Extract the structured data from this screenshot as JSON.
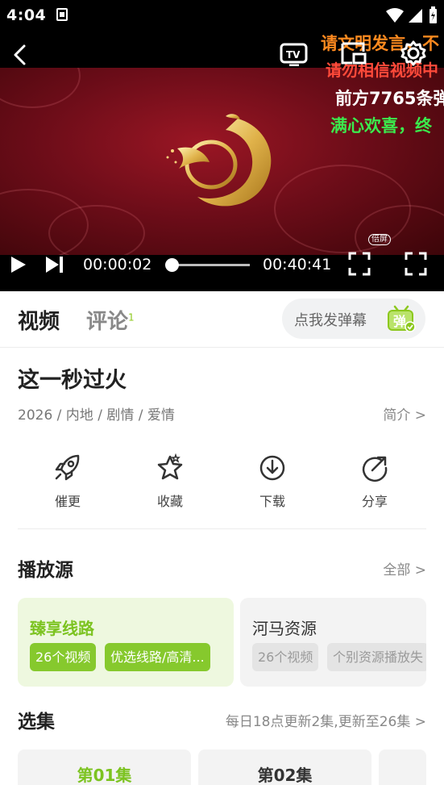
{
  "status_bar": {
    "time": "4:04"
  },
  "player": {
    "danmaku": [
      "请文明发言，不",
      "请勿相信视频中",
      "前方7765条弹",
      "满心欢喜，终"
    ],
    "current_time": "00:00:02",
    "total_time": "00:40:41",
    "speed_tag": "倍屏",
    "progress": 0.02
  },
  "tabs": [
    {
      "label": "视频",
      "active": true
    },
    {
      "label": "评论",
      "badge": "1",
      "active": false
    }
  ],
  "danmu_input": {
    "placeholder": "点我发弹幕",
    "icon_text": "弹"
  },
  "show": {
    "title": "这一秒过火",
    "meta": "2026 / 内地 / 剧情 / 爱情",
    "intro_link": "简介 >"
  },
  "actions": [
    {
      "icon": "rocket-icon",
      "label": "催更"
    },
    {
      "icon": "star-icon",
      "label": "收藏"
    },
    {
      "icon": "download-icon",
      "label": "下载"
    },
    {
      "icon": "share-icon",
      "label": "分享"
    }
  ],
  "sources": {
    "title": "播放源",
    "more": "全部 >",
    "items": [
      {
        "name": "臻享线路",
        "chips": [
          "26个视频",
          "优选线路/高清..."
        ],
        "active": true
      },
      {
        "name": "河马资源",
        "chips": [
          "26个视频",
          "个别资源播放失"
        ],
        "active": false
      }
    ]
  },
  "episodes": {
    "title": "选集",
    "update_info": "每日18点更新2集,更新至26集 >",
    "items": [
      {
        "label": "第01集",
        "active": true
      },
      {
        "label": "第02集",
        "active": false
      },
      {
        "label": "",
        "active": false
      }
    ]
  },
  "colors": {
    "accent": "#86c92d",
    "accent_text": "#7cc320",
    "player_bg": "#6e0d19"
  }
}
